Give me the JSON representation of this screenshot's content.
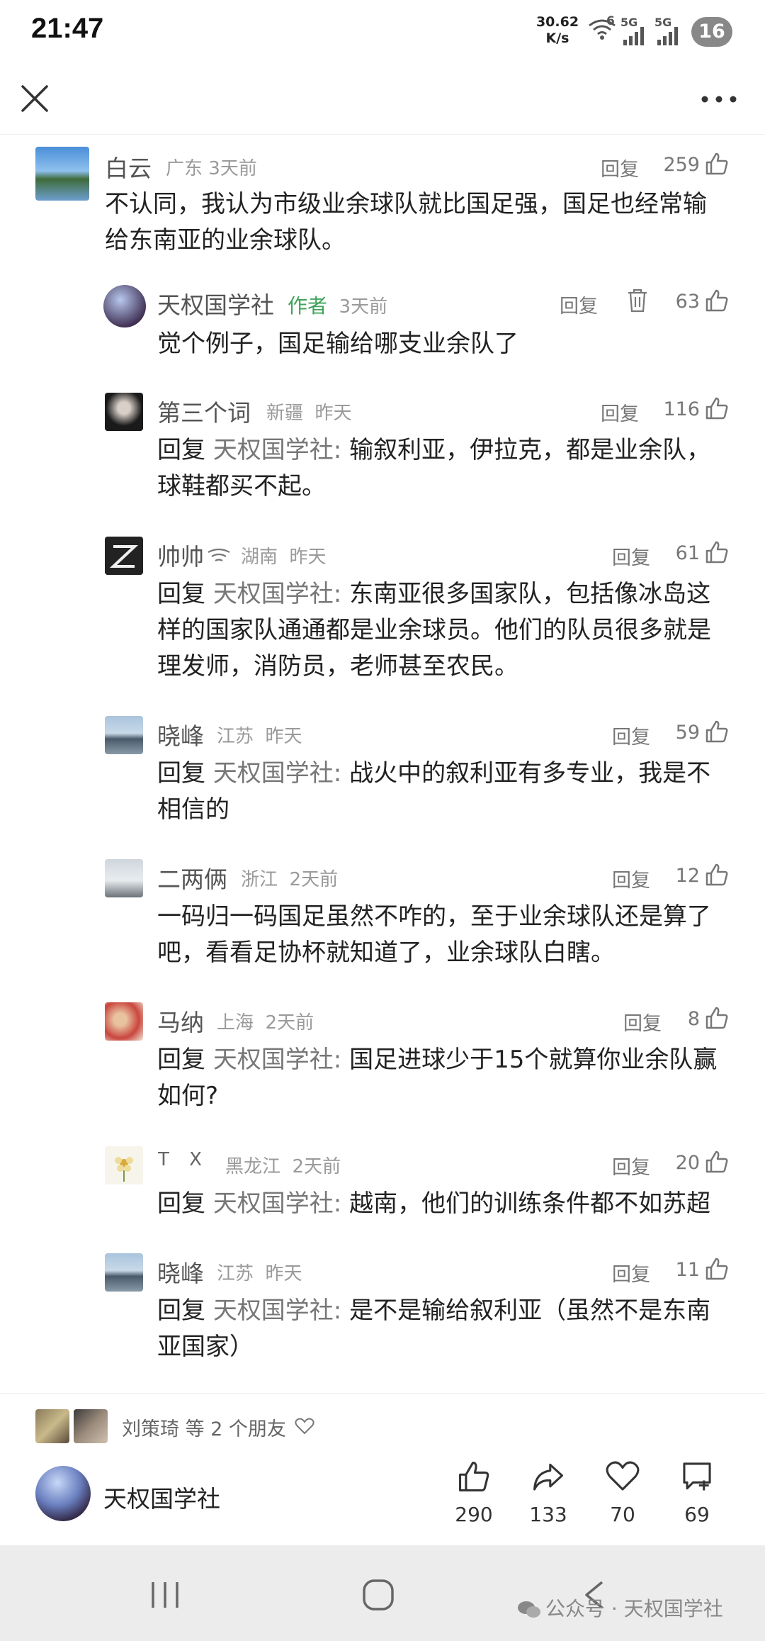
{
  "status": {
    "time": "21:47",
    "speed_value": "30.62",
    "speed_unit": "K/s",
    "wifi_badge": "6",
    "net1": "5G",
    "net2": "5G",
    "battery": "16"
  },
  "comments": [
    {
      "user": "白云",
      "location": "广东",
      "time": "3天前",
      "reply_label": "回复",
      "likes": "259",
      "text": "不认同，我认为市级业余球队就比国足强，国足也经常输给东南亚的业余球队。"
    },
    {
      "user": "天权国学社",
      "author_tag": "作者",
      "time": "3天前",
      "reply_label": "回复",
      "likes": "63",
      "text": "觉个例子，国足输给哪支业余队了"
    },
    {
      "user": "第三个词",
      "location": "新疆",
      "time": "昨天",
      "reply_label": "回复",
      "likes": "116",
      "reply_prefix": "回复",
      "reply_to": "天权国学社:",
      "text": " 输叙利亚，伊拉克，都是业余队，球鞋都买不起。"
    },
    {
      "user": "帅帅",
      "location": "湖南",
      "time": "昨天",
      "reply_label": "回复",
      "likes": "61",
      "reply_prefix": "回复",
      "reply_to": "天权国学社:",
      "text": " 东南亚很多国家队，包括像冰岛这样的国家队通通都是业余球员。他们的队员很多就是理发师，消防员，老师甚至农民。"
    },
    {
      "user": "晓峰",
      "location": "江苏",
      "time": "昨天",
      "reply_label": "回复",
      "likes": "59",
      "reply_prefix": "回复",
      "reply_to": "天权国学社:",
      "text": " 战火中的叙利亚有多专业，我是不相信的"
    },
    {
      "user": "二两俩",
      "location": "浙江",
      "time": "2天前",
      "reply_label": "回复",
      "likes": "12",
      "text": "一码归一码国足虽然不咋的，至于业余球队还是算了吧，看看足协杯就知道了，业余球队白瞎。"
    },
    {
      "user": "马纳",
      "location": "上海",
      "time": "2天前",
      "reply_label": "回复",
      "likes": "8",
      "reply_prefix": "回复",
      "reply_to": "天权国学社:",
      "text": " 国足进球少于15个就算你业余队赢如何?"
    },
    {
      "user": "T X",
      "location": "黑龙江",
      "time": "2天前",
      "reply_label": "回复",
      "likes": "20",
      "reply_prefix": "回复",
      "reply_to": "天权国学社:",
      "text": " 越南，他们的训练条件都不如苏超"
    },
    {
      "user": "晓峰",
      "location": "江苏",
      "time": "昨天",
      "reply_label": "回复",
      "likes": "11",
      "reply_prefix": "回复",
      "reply_to": "天权国学社:",
      "text": " 是不是输给叙利亚（虽然不是东南亚国家）"
    }
  ],
  "friends": {
    "text": "刘策琦 等 2 个朋友"
  },
  "author": {
    "name": "天权国学社"
  },
  "actions": {
    "like": "290",
    "share": "133",
    "fav": "70",
    "comment": "69"
  },
  "watermark": "公众号 · 天权国学社",
  "colors": {
    "author_tag": "#3fa35a",
    "navbar": "#ececec"
  }
}
